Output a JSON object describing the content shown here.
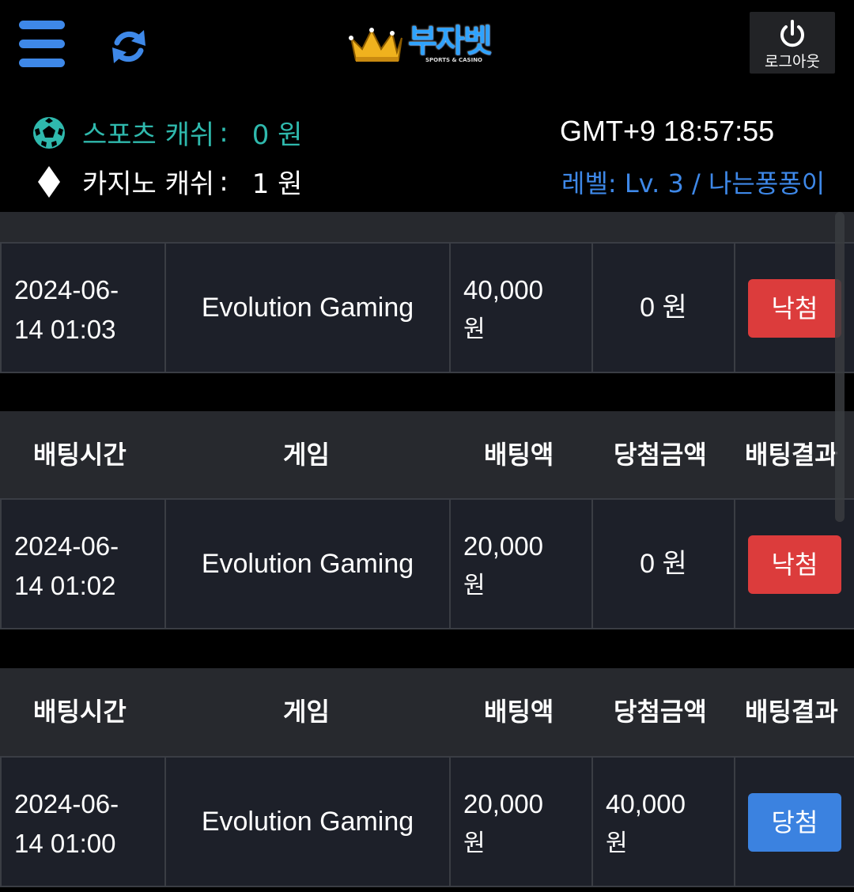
{
  "header": {
    "logo_text": "부자벳",
    "logo_subtitle": "SPORTS & CASINO",
    "logout_label": "로그아웃"
  },
  "account": {
    "sports_cash_label": "스포츠 캐쉬",
    "sports_cash_amount": "0 원",
    "casino_cash_label": "카지노 캐쉬",
    "casino_cash_amount": "1 원",
    "clock": "GMT+9 18:57:55",
    "level": "레벨: Lv. 3 / 나는퐁퐁이"
  },
  "table_headers": {
    "bet_time": "배팅시간",
    "game": "게임",
    "bet_amount": "배팅액",
    "win_amount": "당첨금액",
    "result": "배팅결과"
  },
  "bets": [
    {
      "time": "2024-06-\n14 01:03",
      "game": "Evolution Gaming",
      "bet_amount": "40,000",
      "bet_unit": "원",
      "win_amount": "0 원",
      "result": "낙첨",
      "result_type": "lose"
    },
    {
      "time": "2024-06-\n14 01:02",
      "game": "Evolution Gaming",
      "bet_amount": "20,000",
      "bet_unit": "원",
      "win_amount": "0 원",
      "result": "낙첨",
      "result_type": "lose"
    },
    {
      "time": "2024-06-\n14 01:00",
      "game": "Evolution Gaming",
      "bet_amount": "20,000",
      "bet_unit": "원",
      "win_amount": "40,000",
      "win_unit": "원",
      "result": "당첨",
      "result_type": "win"
    }
  ],
  "colors": {
    "accent_blue": "#3e88e8",
    "sports_teal": "#2fb9ad",
    "lose_red": "#dc3c3c",
    "win_blue": "#3b82e0"
  }
}
